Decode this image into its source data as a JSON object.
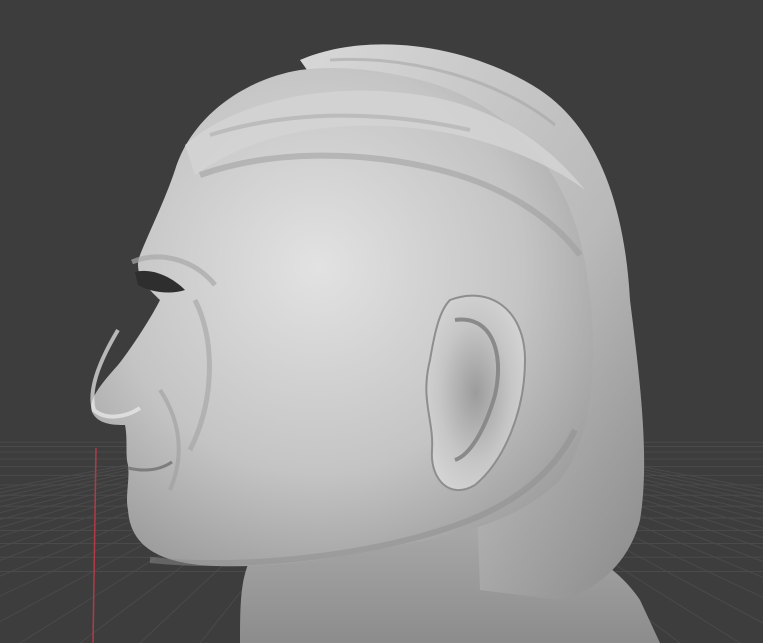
{
  "viewport": {
    "background_color": "#3d3d3d",
    "grid_color": "#4a4a4a",
    "axis_color": "#b23a48",
    "model_color": "#bdbdbd",
    "model_icon": "sculpted-head-model"
  }
}
